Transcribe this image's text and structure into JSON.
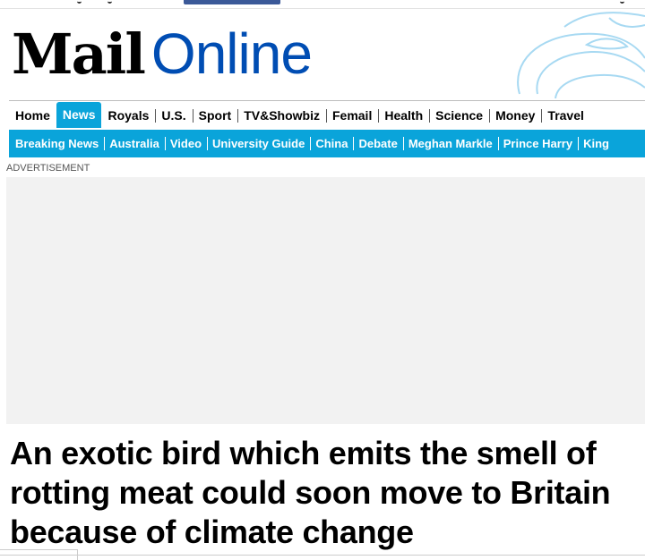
{
  "logo": {
    "mail": "Mail",
    "online": "Online"
  },
  "primary_nav": [
    {
      "label": "Home",
      "active": false
    },
    {
      "label": "News",
      "active": true
    },
    {
      "label": "Royals",
      "active": false
    },
    {
      "label": "U.S.",
      "active": false
    },
    {
      "label": "Sport",
      "active": false
    },
    {
      "label": "TV&Showbiz",
      "active": false
    },
    {
      "label": "Femail",
      "active": false
    },
    {
      "label": "Health",
      "active": false
    },
    {
      "label": "Science",
      "active": false
    },
    {
      "label": "Money",
      "active": false
    },
    {
      "label": "Travel",
      "active": false
    }
  ],
  "secondary_nav": [
    {
      "label": "Breaking News"
    },
    {
      "label": "Australia"
    },
    {
      "label": "Video"
    },
    {
      "label": "University Guide"
    },
    {
      "label": "China"
    },
    {
      "label": "Debate"
    },
    {
      "label": "Meghan Markle"
    },
    {
      "label": "Prince Harry"
    },
    {
      "label": "King"
    }
  ],
  "ad_label": "ADVERTISEMENT",
  "headline": "An exotic bird which emits the smell of rotting meat could soon move to Britain because of climate change",
  "colors": {
    "brand_blue": "#004db3",
    "nav_cyan": "#0aa4da",
    "facebook": "#3b5998"
  },
  "icons": {
    "masthead_decoration": "swirl-icon",
    "facebook_button": "facebook-button"
  }
}
